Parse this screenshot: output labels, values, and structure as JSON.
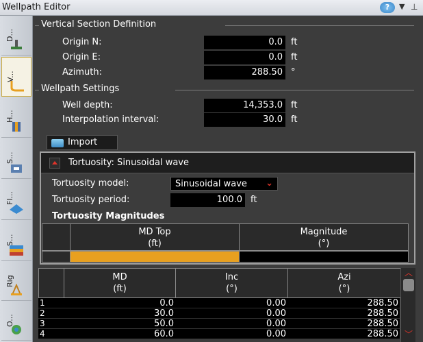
{
  "window": {
    "title": "Wellpath Editor"
  },
  "sidebar": {
    "tabs": [
      {
        "label": "D...",
        "icon": "derrick-icon"
      },
      {
        "label": "V...",
        "icon": "wellpath-icon"
      },
      {
        "label": "H...",
        "icon": "hole-icon"
      },
      {
        "label": "S...",
        "icon": "string-icon"
      },
      {
        "label": "Fl...",
        "icon": "fluid-icon"
      },
      {
        "label": "S...",
        "icon": "strata-icon"
      },
      {
        "label": "Rig",
        "icon": "rig-icon"
      },
      {
        "label": "O...",
        "icon": "operations-icon"
      }
    ]
  },
  "vertical_section": {
    "header": "Vertical Section Definition",
    "origin_n": {
      "label": "Origin N:",
      "value": "0.0",
      "unit": "ft"
    },
    "origin_e": {
      "label": "Origin E:",
      "value": "0.0",
      "unit": "ft"
    },
    "azimuth": {
      "label": "Azimuth:",
      "value": "288.50",
      "unit": "°"
    }
  },
  "wellpath_settings": {
    "header": "Wellpath Settings",
    "well_depth": {
      "label": "Well depth:",
      "value": "14,353.0",
      "unit": "ft"
    },
    "interpolation": {
      "label": "Interpolation interval:",
      "value": "30.0",
      "unit": "ft"
    }
  },
  "import_button": "Import",
  "tortuosity": {
    "title": "Tortuosity: Sinusoidal wave",
    "model_label": "Tortuosity model:",
    "model_value": "Sinusoidal wave",
    "period_label": "Tortuosity period:",
    "period_value": "100.0",
    "period_unit": "ft",
    "magnitudes_title": "Tortuosity Magnitudes",
    "columns": [
      {
        "name": "MD Top",
        "unit": "(ft)"
      },
      {
        "name": "Magnitude",
        "unit": "(°)"
      }
    ]
  },
  "main_grid": {
    "columns": [
      {
        "name": "MD",
        "unit": "(ft)"
      },
      {
        "name": "Inc",
        "unit": "(°)"
      },
      {
        "name": "Azi",
        "unit": "(°)"
      }
    ],
    "rows": [
      {
        "n": "1",
        "md": "0.0",
        "inc": "0.00",
        "azi": "288.50"
      },
      {
        "n": "2",
        "md": "30.0",
        "inc": "0.00",
        "azi": "288.50"
      },
      {
        "n": "3",
        "md": "50.0",
        "inc": "0.00",
        "azi": "288.50"
      },
      {
        "n": "4",
        "md": "60.0",
        "inc": "0.00",
        "azi": "288.50"
      }
    ]
  },
  "colors": {
    "accent": "#e8a020",
    "scroll_arrow": "#e0342a"
  }
}
